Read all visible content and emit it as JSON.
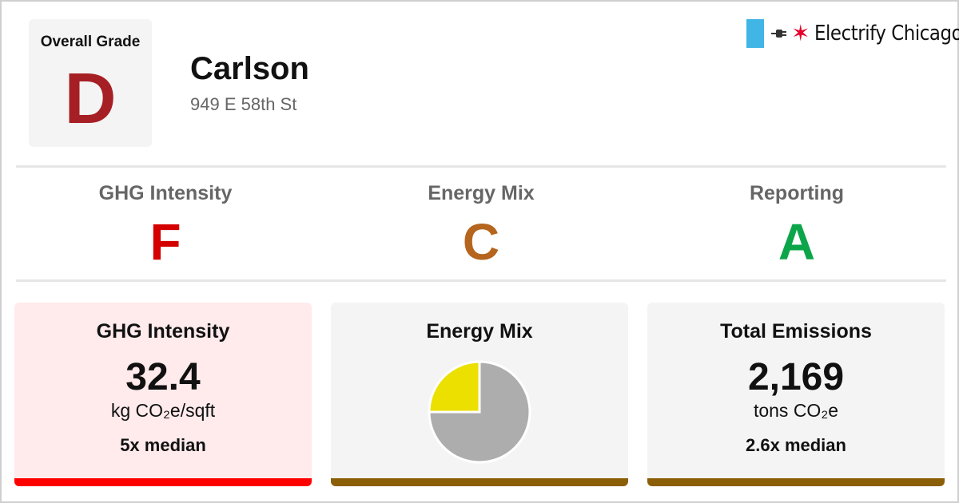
{
  "header": {
    "overall_grade_label": "Overall Grade",
    "overall_grade": "D",
    "building_name": "Carlson",
    "address": "949 E 58th St",
    "brand_name": "Electrify Chicago",
    "brand_icons": [
      "chicago-flag-icon",
      "plug-icon",
      "red-star-icon"
    ]
  },
  "sub_grades": [
    {
      "label": "GHG Intensity",
      "grade": "F",
      "color": "#d40000"
    },
    {
      "label": "Energy Mix",
      "grade": "C",
      "color": "#b5651d"
    },
    {
      "label": "Reporting",
      "grade": "A",
      "color": "#0ca54a"
    }
  ],
  "cards": {
    "ghg": {
      "title": "GHG Intensity",
      "value": "32.4",
      "unit": "kg CO₂e/sqft",
      "median": "5x median",
      "bg": "#ffeaec",
      "bar": "#ff0000"
    },
    "energy_mix": {
      "title": "Energy Mix",
      "bg": "#f4f4f4",
      "bar": "#8b5e08"
    },
    "total": {
      "title": "Total Emissions",
      "value": "2,169",
      "unit": "tons CO₂e",
      "median": "2.6x median",
      "bg": "#f4f4f4",
      "bar": "#8b5e08"
    }
  },
  "chart_data": {
    "type": "pie",
    "title": "",
    "slices": [
      {
        "value": 75,
        "color": "#adadad"
      },
      {
        "value": 25,
        "color": "#ece000"
      }
    ]
  },
  "colors": {
    "overall_grade": "#a61f24",
    "divider": "#e6e6e6",
    "grade_box_bg": "#f4f4f4"
  }
}
